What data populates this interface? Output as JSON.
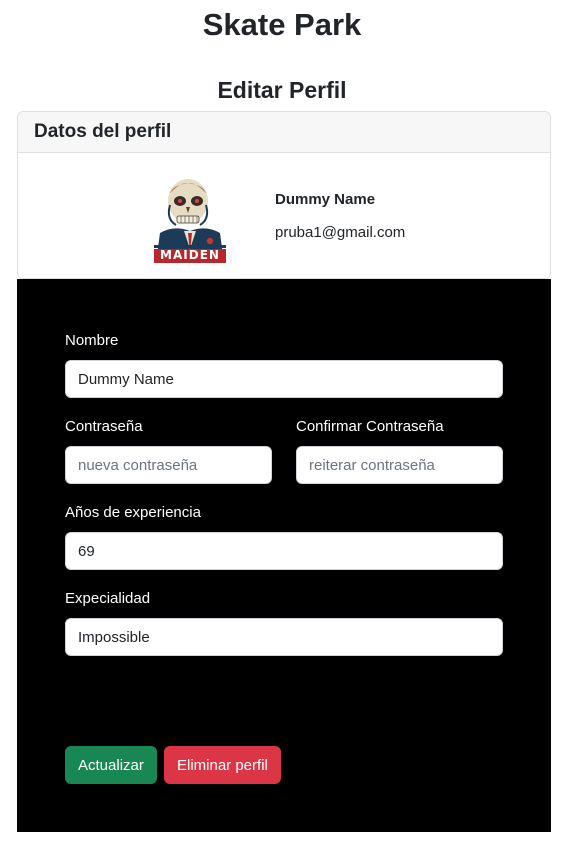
{
  "site": {
    "title": "Skate Park"
  },
  "page": {
    "title": "Editar Perfil"
  },
  "profile_card": {
    "header": "Datos del perfil",
    "name": "Dummy Name",
    "email": "pruba1@gmail.com",
    "avatar_caption": "MAIDEN"
  },
  "form": {
    "name": {
      "label": "Nombre",
      "value": "Dummy Name"
    },
    "password": {
      "label": "Contraseña",
      "value": "",
      "placeholder": "nueva contraseña"
    },
    "confirm_password": {
      "label": "Confirmar Contraseña",
      "value": "",
      "placeholder": "reiterar contraseña"
    },
    "experience": {
      "label": "Años de experiencia",
      "value": "69"
    },
    "specialty": {
      "label": "Expecialidad",
      "value": "Impossible"
    },
    "update_label": "Actualizar",
    "delete_label": "Eliminar perfil"
  },
  "colors": {
    "update_button": "#198754",
    "delete_button": "#dc3545",
    "form_background": "#000000",
    "card_header_background": "#f7f7f7"
  }
}
